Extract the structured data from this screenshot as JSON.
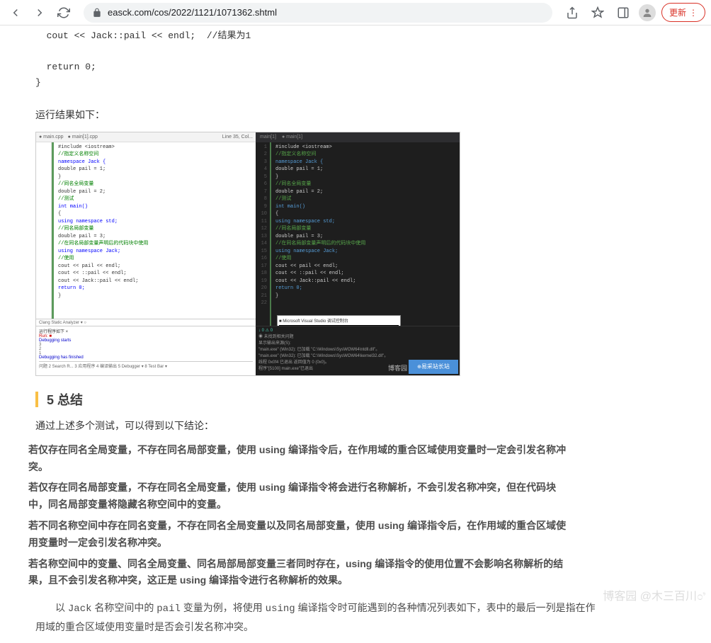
{
  "browser": {
    "url": "easck.com/cos/2022/1121/1071362.shtml",
    "update": "更新"
  },
  "code_top": "  cout << Jack::pail << endl;  //结果为1\n\n  return 0;\n}",
  "run_result": "运行结果如下：",
  "ide": {
    "left_tab1": "● main.cpp",
    "left_tab2": "● main[1].cpp",
    "left_line_info": "Line 35, Col...",
    "left_code_lines": [
      {
        "t": "#include <iostream>",
        "c": ""
      },
      {
        "t": "//指定义名称空间",
        "c": "cm"
      },
      {
        "t": "namespace Jack {",
        "c": "kw"
      },
      {
        "t": "    double pail = 1;",
        "c": ""
      },
      {
        "t": "}",
        "c": ""
      },
      {
        "t": "//同名全局变量",
        "c": "cm"
      },
      {
        "t": "double pail = 2;",
        "c": ""
      },
      {
        "t": "//测试",
        "c": "cm"
      },
      {
        "t": "int main()",
        "c": "kw"
      },
      {
        "t": "{",
        "c": ""
      },
      {
        "t": "    using namespace std;",
        "c": "kw"
      },
      {
        "t": "    //同名局部变量",
        "c": "cm"
      },
      {
        "t": "    double pail = 3;",
        "c": ""
      },
      {
        "t": "    //在同名局部变量声明后的代码块中使用",
        "c": "cm"
      },
      {
        "t": "    using namespace Jack;",
        "c": "kw"
      },
      {
        "t": "    //使用",
        "c": "cm"
      },
      {
        "t": "    cout << pail << endl;",
        "c": ""
      },
      {
        "t": "    cout << ::pail << endl;",
        "c": ""
      },
      {
        "t": "    cout << Jack::pail << endl;",
        "c": ""
      },
      {
        "t": "",
        "c": ""
      },
      {
        "t": "    return 0;",
        "c": "kw"
      },
      {
        "t": "}",
        "c": ""
      }
    ],
    "analyzer": "Clang Static Analyzer ▾ ○",
    "debug_panel": "运行程序如下 ×",
    "run_out1": "Run: ■",
    "run_out2": "Debugging starts",
    "run_out3": "3",
    "run_out4": "2",
    "run_out5": "1",
    "run_out6": "Debugging has finished",
    "tabs_bottom": "问题  2 Search R...  3 应用程序  4 编译输出  5 Debugger ▾  8 Test Bar ▾",
    "right_tab": "main[1]",
    "right_tab2": "● main[1]",
    "right_code_lines": [
      {
        "t": "#include <iostream>",
        "c": ""
      },
      {
        "t": "//指定义名称空间",
        "c": "dcm"
      },
      {
        "t": "namespace Jack {",
        "c": "dkw"
      },
      {
        "t": "    double pail = 1;",
        "c": ""
      },
      {
        "t": "}",
        "c": ""
      },
      {
        "t": "//同名全局变量",
        "c": "dcm"
      },
      {
        "t": "double pail = 2;",
        "c": ""
      },
      {
        "t": "//测试",
        "c": "dcm"
      },
      {
        "t": "int main()",
        "c": "dkw"
      },
      {
        "t": "{",
        "c": ""
      },
      {
        "t": "    using namespace std;",
        "c": "dkw"
      },
      {
        "t": "    //同名局部变量",
        "c": "dcm"
      },
      {
        "t": "    double pail = 3;",
        "c": ""
      },
      {
        "t": "    //在同名局部变量声明后的代码块中使用",
        "c": "dcm"
      },
      {
        "t": "    using namespace Jack;",
        "c": "dkw"
      },
      {
        "t": "    //使用",
        "c": "dcm"
      },
      {
        "t": "    cout << pail << endl;",
        "c": ""
      },
      {
        "t": "    cout << ::pail << endl;",
        "c": ""
      },
      {
        "t": "    cout << Jack::pail << endl;",
        "c": ""
      },
      {
        "t": "",
        "c": ""
      },
      {
        "t": "    return 0;",
        "c": "dkw"
      },
      {
        "t": "}",
        "c": ""
      }
    ],
    "popup_title": "■ Microsoft Visual Studio 调试控制台",
    "right_bottom1": "◉ 未找到相关问题",
    "right_bottom2": "显示输出来源(S):",
    "right_bottom3": "\"main.exe\" (Win32): 已加载 \"C:\\Windows\\SysWOW64\\ntdll.dll\"。",
    "right_bottom4": "\"main.exe\" (Win32): 已加载 \"C:\\Windows\\SysWOW64\\kernel32.dll\"。",
    "right_bottom5": "线程 0x0f4 已退出 返回值为 0 (0x0)。",
    "right_bottom6": "程序\"[5100] main.exe\"已退出",
    "right_status": "↓ 0   ⚠ 0",
    "watermark1": "博客园",
    "watermark2": "易采站长站"
  },
  "heading": "5 总结",
  "summary_intro": "通过上述多个测试，可以得到以下结论：",
  "bp1": "若仅存在同名全局变量，不存在同名局部变量，使用 using 编译指令后，在作用域的重合区域使用变量时一定会引发名称冲突。",
  "bp2": "若仅存在同名局部变量，不存在同名全局变量，使用 using 编译指令将会进行名称解析，不会引发名称冲突，但在代码块中，同名局部变量将隐藏名称空间中的变量。",
  "bp3": "若不同名称空间中存在同名变量，不存在同名全局变量以及同名局部变量，使用 using 编译指令后，在作用域的重合区域使用变量时一定会引发名称冲突。",
  "bp4": "若名称空间中的变量、同名全局变量、同名局部局部变量三者同时存在，using 编译指令的使用位置不会影响名称解析的结果，且不会引发名称冲突，这正是 using 编译指令进行名称解析的效果。",
  "final1_pre": "以 ",
  "final1_mid1": "Jack",
  "final1_mid2": " 名称空间中的 ",
  "final1_mid3": "pail",
  "final1_mid4": " 变量为例，将使用 ",
  "final1_mid5": "using",
  "final1_post": " 编译指令时可能遇到的各种情况列表如下，表中的最后一列是指在作用域的重合区域使用变量时是否会引发名称冲突。",
  "footer_wm": "博客园 @木三百川೦ಿ"
}
